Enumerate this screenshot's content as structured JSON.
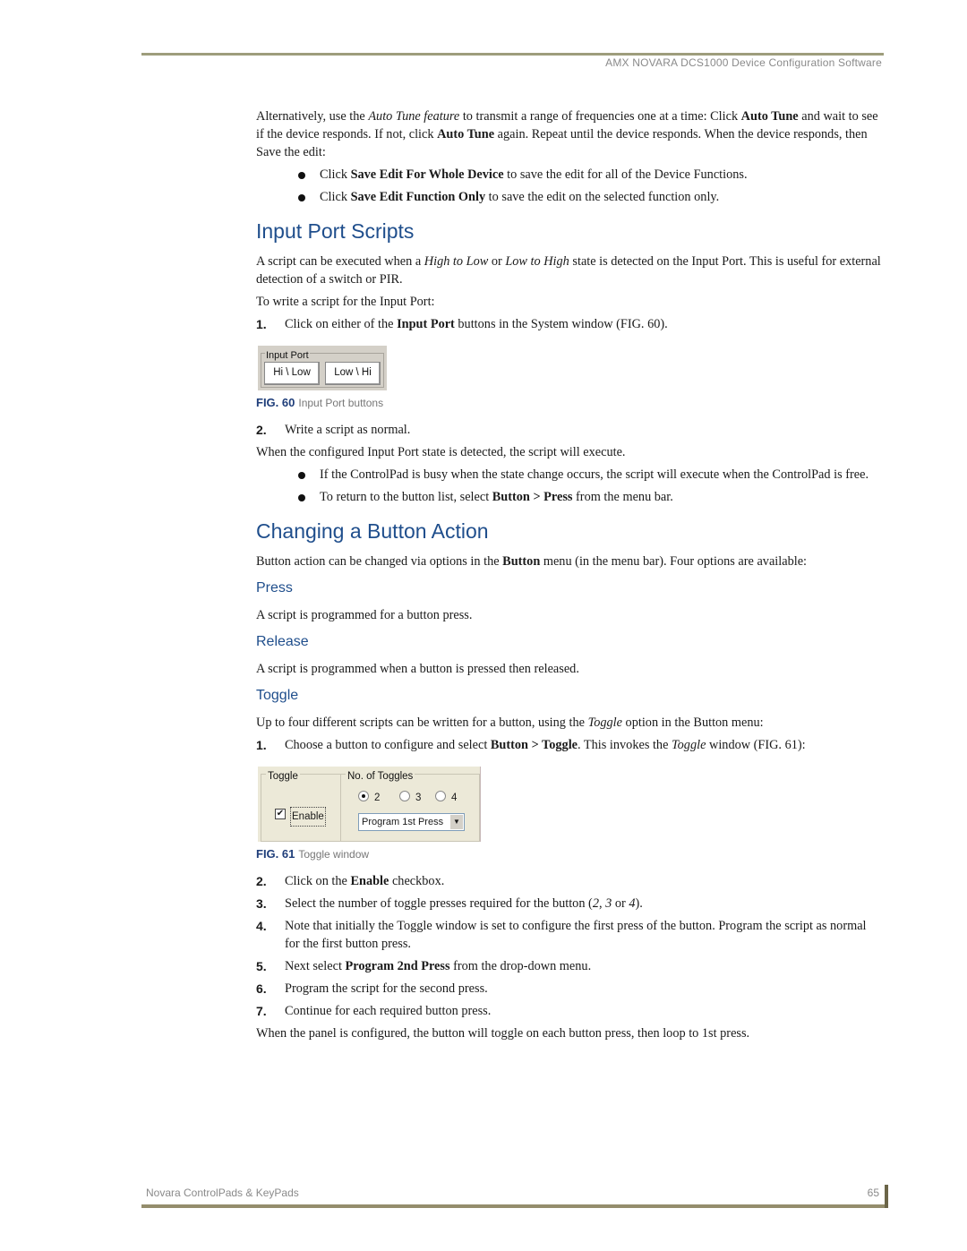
{
  "header": {
    "title": "AMX NOVARA DCS1000 Device Configuration Software"
  },
  "intro": {
    "p1": [
      "Alternatively, use the ",
      "Auto Tune feature",
      " to transmit a range of frequencies one at a time: Click ",
      "Auto Tune",
      " and wait to see if the device responds. If not, click ",
      "Auto Tune",
      " again. Repeat until the device responds. When the device responds, then Save the edit:"
    ],
    "bullets": [
      [
        "Click ",
        "Save Edit For Whole Device",
        " to save the edit for all of the Device Functions."
      ],
      [
        "Click ",
        "Save Edit Function Only",
        " to save the edit on the selected function only."
      ]
    ]
  },
  "input_port": {
    "heading": "Input Port Scripts",
    "p1": [
      "A script can be executed when a ",
      "High to Low",
      " or ",
      "Low to High",
      " state is detected on the Input Port. This is useful for external detection of a switch or PIR."
    ],
    "p2": "To write a script for the Input Port:",
    "step1": {
      "n": "1.",
      "parts": [
        "Click on either of the ",
        "Input Port",
        " buttons in the System window (FIG. 60)."
      ]
    },
    "fig": {
      "group_label": "Input Port",
      "btn1": "Hi \\ Low",
      "btn2": "Low \\ Hi",
      "cap_num": "FIG. 60",
      "cap_text": "Input Port buttons"
    },
    "step2": {
      "n": "2.",
      "text": "Write a script as normal."
    },
    "p3": "When the configured Input Port state is detected, the script will execute.",
    "bullets": [
      [
        "If the ControlPad is busy when the state change occurs, the script will execute when the ControlPad is free."
      ],
      [
        "To return to the button list, select ",
        "Button > Press",
        " from the menu bar."
      ]
    ]
  },
  "changing": {
    "heading": "Changing a Button Action",
    "p1": [
      "Button action can be changed via options in the ",
      "Button",
      " menu (in the menu bar). Four options are available:"
    ],
    "press": {
      "heading": "Press",
      "text": "A script is programmed for a button press."
    },
    "release": {
      "heading": "Release",
      "text": "A script is programmed when a button is pressed then released."
    },
    "toggle": {
      "heading": "Toggle",
      "p1": [
        "Up to four different scripts can be written for a button, using the ",
        "Toggle",
        " option in the Button menu:"
      ],
      "step1": {
        "n": "1.",
        "parts": [
          "Choose a button to configure and select ",
          "Button > Toggle",
          ". This invokes the ",
          "Toggle",
          " window (FIG. 61):"
        ]
      },
      "fig": {
        "group1": "Toggle",
        "enable": "Enable",
        "enabled": true,
        "group2": "No. of Toggles",
        "opt2": "2",
        "opt3": "3",
        "opt4": "4",
        "selected": "2",
        "dropdown": "Program 1st Press",
        "cap_num": "FIG. 61",
        "cap_text": "Toggle window"
      },
      "steps": [
        {
          "n": "2.",
          "parts": [
            "Click on the ",
            "Enable",
            " checkbox."
          ]
        },
        {
          "n": "3.",
          "parts": [
            "Select the number of toggle presses required for the button (",
            "2",
            ", ",
            "3",
            " or ",
            "4",
            ")."
          ]
        },
        {
          "n": "4.",
          "parts": [
            "Note that initially the Toggle window is set to configure the first press of the button. Program the script as normal for the first button press."
          ]
        },
        {
          "n": "5.",
          "parts": [
            "Next select ",
            "Program 2nd Press",
            " from the drop-down menu."
          ]
        },
        {
          "n": "6.",
          "parts": [
            "Program the script for the second press."
          ]
        },
        {
          "n": "7.",
          "parts": [
            "Continue for each required button press."
          ]
        }
      ],
      "closing": "When the panel is configured, the button will toggle on each button press, then loop to 1st press."
    }
  },
  "footer": {
    "title": "Novara ControlPads  & KeyPads",
    "page": "65"
  }
}
